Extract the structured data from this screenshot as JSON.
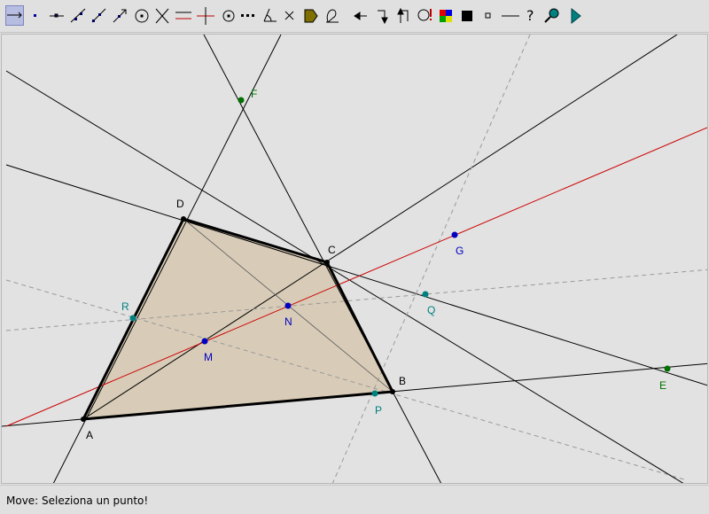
{
  "app": {
    "status_text": "Move: Seleziona un punto!"
  },
  "toolbar": {
    "tools": [
      {
        "name": "move-tool",
        "icon": "move-arrow-icon",
        "active": true
      },
      {
        "name": "point-tool",
        "icon": "point-icon"
      },
      {
        "name": "segment-tool",
        "icon": "segment-icon"
      },
      {
        "name": "line-tool",
        "icon": "line-icon"
      },
      {
        "name": "ray-tool",
        "icon": "ray-icon"
      },
      {
        "name": "vector-tool",
        "icon": "vector-icon"
      },
      {
        "name": "circle-tool",
        "icon": "circle-icon"
      },
      {
        "name": "intersect-tool",
        "icon": "intersect-icon"
      },
      {
        "name": "parallel-tool",
        "icon": "parallel-icon"
      },
      {
        "name": "perpendicular-tool",
        "icon": "perpendicular-icon"
      },
      {
        "name": "midpoint-tool",
        "icon": "midpoint-icon"
      },
      {
        "name": "symmetry-tool",
        "icon": "symmetry-icon"
      },
      {
        "name": "angle-tool",
        "icon": "angle-icon"
      },
      {
        "name": "delete-tool",
        "icon": "delete-icon"
      },
      {
        "name": "polygon-tool",
        "icon": "polygon-icon"
      },
      {
        "name": "measure-tool",
        "icon": "measure-icon"
      },
      {
        "name": "undo-tool",
        "icon": "undo-arrow-icon"
      },
      {
        "name": "step-tool",
        "icon": "step-icon"
      },
      {
        "name": "step-back-tool",
        "icon": "step-back-icon"
      },
      {
        "name": "check-tool",
        "icon": "check-icon"
      },
      {
        "name": "color-tool",
        "icon": "color-palette-icon"
      },
      {
        "name": "fill-tool",
        "icon": "fill-square-icon"
      },
      {
        "name": "point-style-tool",
        "icon": "point-style-icon"
      },
      {
        "name": "line-style-tool",
        "icon": "line-style-icon"
      },
      {
        "name": "help-tool",
        "icon": "help-icon"
      },
      {
        "name": "zoom-tool",
        "icon": "magnifier-icon"
      },
      {
        "name": "play-tool",
        "icon": "play-icon"
      }
    ]
  },
  "figure": {
    "points": [
      {
        "label": "A",
        "color": "#000000"
      },
      {
        "label": "B",
        "color": "#000000"
      },
      {
        "label": "C",
        "color": "#000000"
      },
      {
        "label": "D",
        "color": "#000000"
      },
      {
        "label": "E",
        "color": "#007000"
      },
      {
        "label": "F",
        "color": "#007000"
      },
      {
        "label": "G",
        "color": "#0000c0"
      },
      {
        "label": "M",
        "color": "#0000c0"
      },
      {
        "label": "N",
        "color": "#0000c0"
      },
      {
        "label": "P",
        "color": "#008080"
      },
      {
        "label": "Q",
        "color": "#008080"
      },
      {
        "label": "R",
        "color": "#008080"
      }
    ],
    "polygon_fill": "#d8ccb8",
    "newton_line_color": "#cc0000"
  }
}
